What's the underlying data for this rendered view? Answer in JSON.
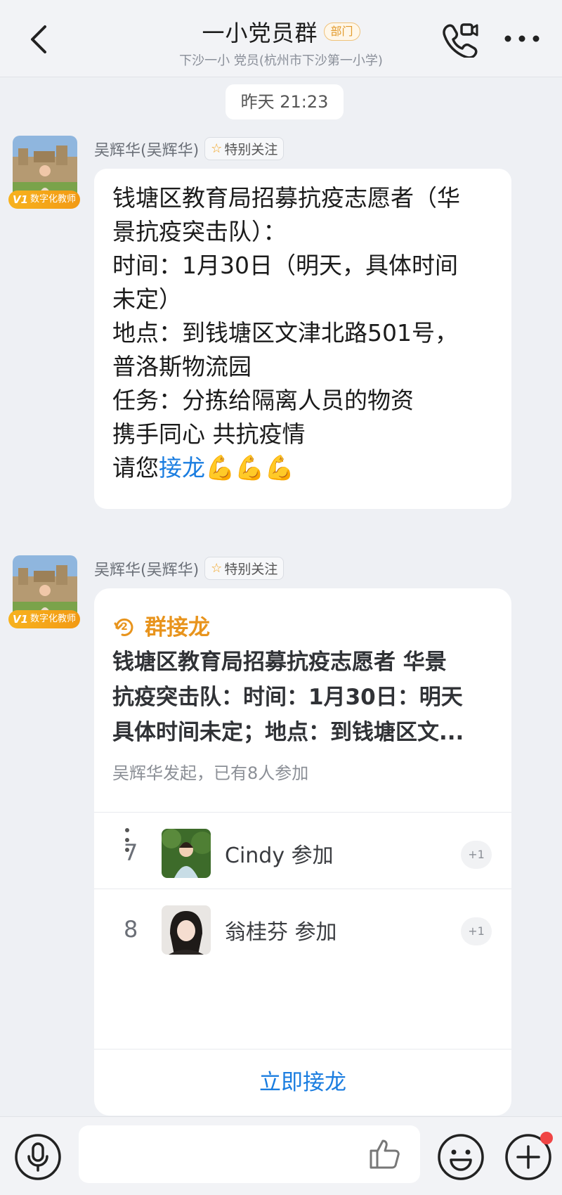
{
  "header": {
    "title": "一小党员群",
    "dept_badge": "部门",
    "subtitle": "下沙一小 党员(杭州市下沙第一小学)"
  },
  "timestamp": "昨天 21:23",
  "messages": [
    {
      "sender": "吴辉华(吴辉华)",
      "follow_badge": "特别关注",
      "avatar_tag": "数字化教师",
      "avatar_tag_level": "V1",
      "lines": [
        "钱塘区教育局招募抗疫志愿者（华",
        "景抗疫突击队）：",
        "时间：1月30日（明天，具体时间",
        "未定）",
        "地点：到钱塘区文津北路501号，",
        "普洛斯物流园",
        "任务：分拣给隔离人员的物资",
        "携手同心 共抗疫情"
      ],
      "last_line_prefix": "请您",
      "last_line_link": "接龙",
      "last_line_emoji": "💪💪💪"
    },
    {
      "sender": "吴辉华(吴辉华)",
      "follow_badge": "特别关注",
      "avatar_tag": "数字化教师",
      "avatar_tag_level": "V1",
      "card": {
        "label": "群接龙",
        "title_lines": [
          "钱塘区教育局招募抗疫志愿者 华景",
          "抗疫突击队：时间：1月30日：明天",
          "具体时间未定；地点：到钱塘区文..."
        ],
        "meta": "吴辉华发起，已有8人参加",
        "rows": [
          {
            "num": "7",
            "name": "Cindy 参加",
            "plus": "+1"
          },
          {
            "num": "8",
            "name": "翁桂芬 参加",
            "plus": "+1"
          }
        ],
        "join_label": "立即接龙"
      }
    }
  ],
  "input": {
    "placeholder": ""
  },
  "icons": {
    "back": "chevron-left-icon",
    "call": "phone-video-icon",
    "more": "more-horizontal-icon",
    "voice": "microphone-icon",
    "thumb": "thumbs-up-icon",
    "emoji": "smiley-icon",
    "plus": "plus-circle-icon"
  },
  "colors": {
    "accent_blue": "#1a7de0",
    "relay_orange": "#e8941d",
    "badge_orange": "#e29a2b",
    "background": "#eef0f4"
  }
}
